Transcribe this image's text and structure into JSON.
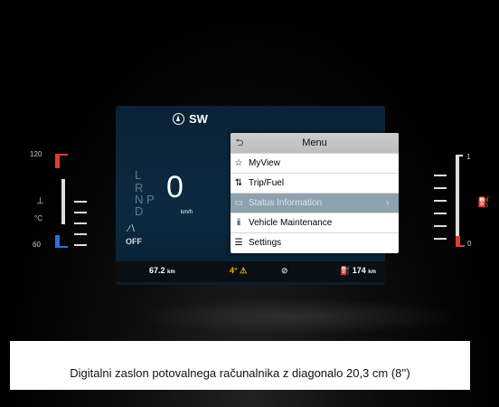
{
  "cluster": {
    "heading": "SW",
    "gears": [
      "L",
      "R",
      "N",
      "P",
      "D"
    ],
    "speed": "0",
    "speed_unit": "km/h",
    "auto_wipe_label": "OFF"
  },
  "menu": {
    "title": "Menu",
    "back_icon": "back-arrow-icon",
    "items": [
      {
        "label": "MyView",
        "icon": "star-icon"
      },
      {
        "label": "Trip/Fuel",
        "icon": "trip-icon"
      },
      {
        "label": "Status Information",
        "icon": "car-icon",
        "selected": true
      },
      {
        "label": "Vehicle Maintenance",
        "icon": "wrench-icon"
      },
      {
        "label": "Settings",
        "icon": "sliders-icon"
      }
    ]
  },
  "bottom_bar": {
    "odometer": "67.2",
    "odometer_unit": "km",
    "outside_temp": "4°",
    "range": "174",
    "range_unit": "km"
  },
  "temp_gauge": {
    "max_label": "120",
    "min_label": "60",
    "unit": "°C"
  },
  "fuel_gauge": {
    "full_label": "1",
    "empty_label": "0"
  },
  "caption": "Digitalni zaslon potovalnega računalnika z diagonalo 20,3 cm (8'')",
  "colors": {
    "screen_bg": "#0b2a42",
    "menu_selected": "#8ea1ae",
    "warning_amber": "#f0b400",
    "gauge_red": "#e23b2e",
    "gauge_blue": "#2f6fd8"
  }
}
